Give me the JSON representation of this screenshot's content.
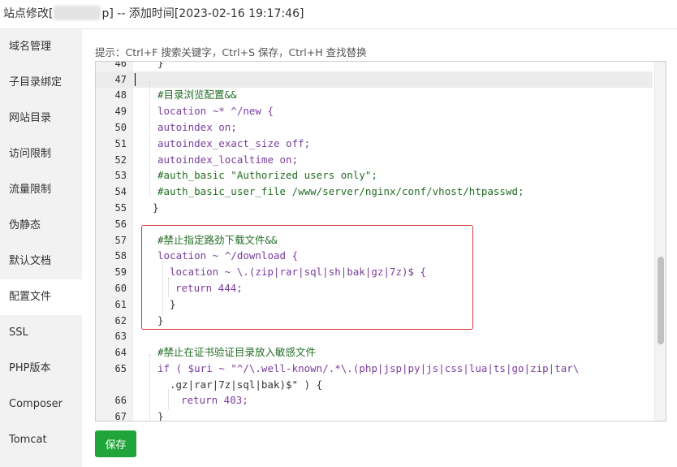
{
  "window": {
    "title_prefix": "站点修改[",
    "title_suffix": "p] -- 添加时间[2023-02-16 19:17:46]"
  },
  "sidebar": {
    "items": [
      {
        "label": "域名管理"
      },
      {
        "label": "子目录绑定"
      },
      {
        "label": "网站目录"
      },
      {
        "label": "访问限制"
      },
      {
        "label": "流量限制"
      },
      {
        "label": "伪静态"
      },
      {
        "label": "默认文档"
      },
      {
        "label": "配置文件",
        "active": true
      },
      {
        "label": "SSL"
      },
      {
        "label": "PHP版本"
      },
      {
        "label": "Composer"
      },
      {
        "label": "Tomcat"
      }
    ]
  },
  "hint": "提示：Ctrl+F 搜索关键字，Ctrl+S 保存，Ctrl+H 查找替换",
  "editor": {
    "lines": [
      {
        "num": "46",
        "code": "}"
      },
      {
        "num": "47",
        "code": ""
      },
      {
        "num": "48",
        "code": "#目录浏览配置&&"
      },
      {
        "num": "49",
        "code": "location ~* ^/new {"
      },
      {
        "num": "50",
        "code": "autoindex on;"
      },
      {
        "num": "51",
        "code": "autoindex_exact_size off;"
      },
      {
        "num": "52",
        "code": "autoindex_localtime on;"
      },
      {
        "num": "53",
        "code": "#auth_basic \"Authorized users only\";"
      },
      {
        "num": "54",
        "code": "#auth_basic_user_file /www/server/nginx/conf/vhost/htpasswd;"
      },
      {
        "num": "55",
        "code": "}"
      },
      {
        "num": "56",
        "code": ""
      },
      {
        "num": "57",
        "code": "#禁止指定路劲下载文件&&"
      },
      {
        "num": "58",
        "code": "location ~ ^/download {"
      },
      {
        "num": "59",
        "code": "location ~ \\.(zip|rar|sql|sh|bak|gz|7z)$ {"
      },
      {
        "num": "60",
        "code": "return 444;"
      },
      {
        "num": "61",
        "code": "}"
      },
      {
        "num": "62",
        "code": "}"
      },
      {
        "num": "63",
        "code": ""
      },
      {
        "num": "64",
        "code": "#禁止在证书验证目录放入敏感文件"
      },
      {
        "num": "65",
        "code": "if ( $uri ~ \"^/\\.well-known/.*\\.(php|jsp|py|js|css|lua|ts|go|zip|tar\\"
      },
      {
        "num": "",
        "code": ".gz|rar|7z|sql|bak)$\" ) {"
      },
      {
        "num": "66",
        "code": "return 403;"
      },
      {
        "num": "67",
        "code": "}"
      }
    ]
  },
  "save_label": "保存",
  "colors": {
    "accent_green": "#20a53a",
    "highlight_red": "#d33a3a",
    "comment_green": "#236e25",
    "keyword_purple": "#7a3e9d",
    "value_blue": "#1a1aa6"
  }
}
